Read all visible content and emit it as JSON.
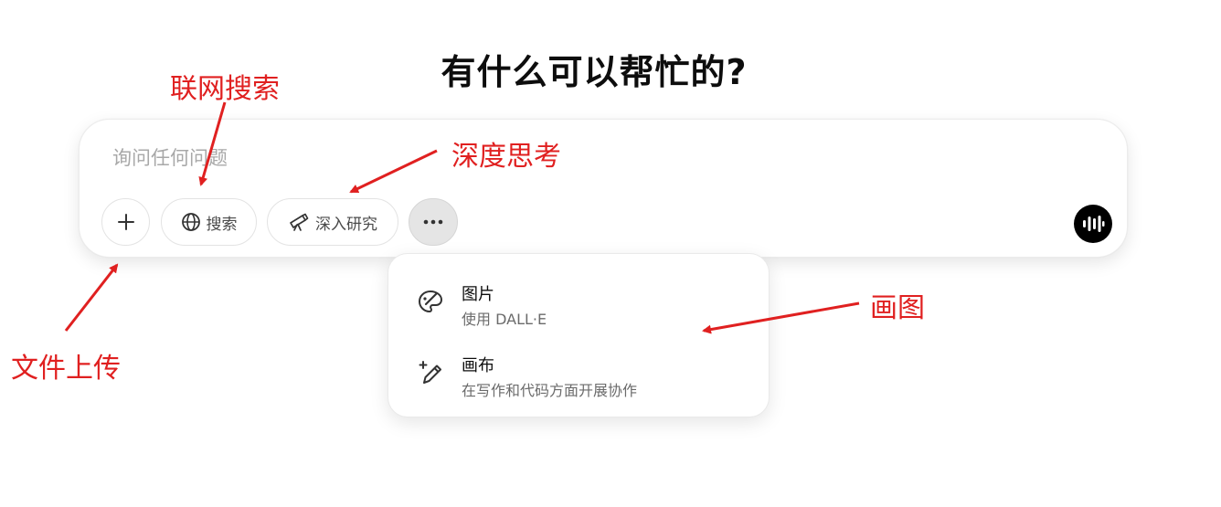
{
  "title": "有什么可以帮忙的?",
  "composer": {
    "placeholder": "询问任何问题",
    "buttons": {
      "add_icon": "plus-icon",
      "search_label": "搜索",
      "search_icon": "globe-icon",
      "research_label": "深入研究",
      "research_icon": "telescope-icon",
      "more_icon": "ellipsis-icon",
      "voice_icon": "voice-waveform-icon"
    }
  },
  "more_menu": {
    "items": [
      {
        "title": "图片",
        "subtitle": "使用 DALL·E",
        "icon": "palette-icon"
      },
      {
        "title": "画布",
        "subtitle": "在写作和代码方面开展协作",
        "icon": "sparkle-pen-icon"
      }
    ]
  },
  "annotations": {
    "search": "联网搜索",
    "deep_think": "深度思考",
    "file_upload": "文件上传",
    "draw": "画图"
  },
  "colors": {
    "annotation": "#e02020",
    "more_button_bg": "#e5e5e5",
    "voice_button_bg": "#000000"
  }
}
